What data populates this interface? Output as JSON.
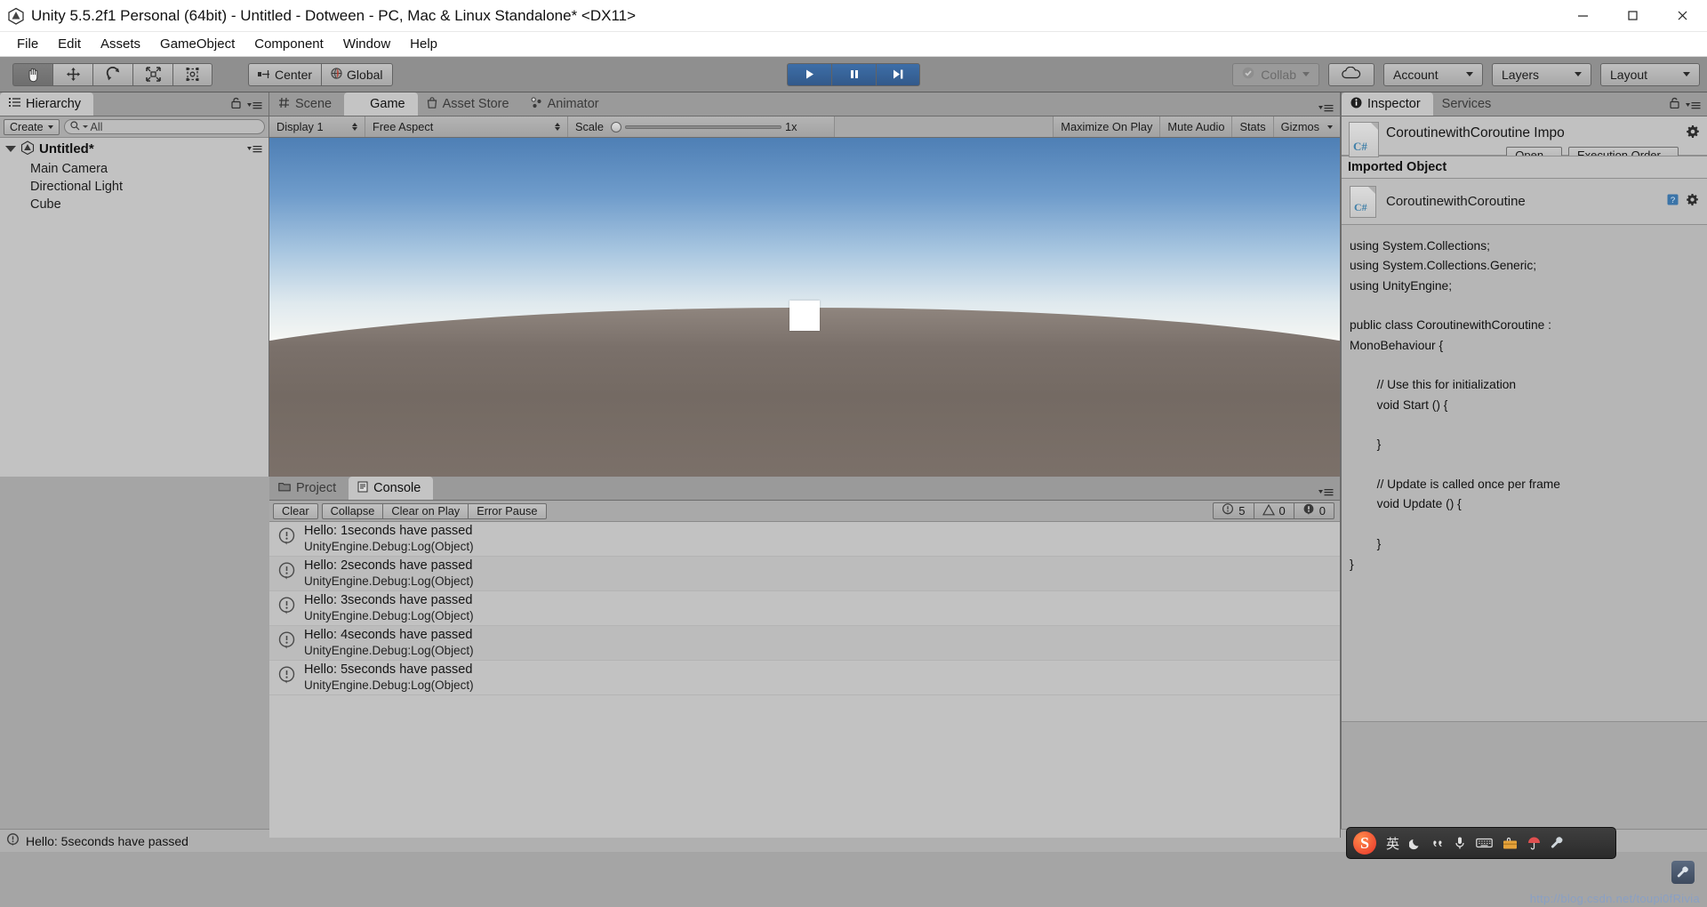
{
  "window": {
    "title": "Unity 5.5.2f1 Personal (64bit) - Untitled - Dotween - PC, Mac & Linux Standalone* <DX11>",
    "logo_icon": "unity-logo-icon",
    "minimize_icon": "minimize-icon",
    "maximize_icon": "maximize-icon",
    "close_icon": "close-icon"
  },
  "menubar": {
    "items": [
      {
        "label": "File"
      },
      {
        "label": "Edit"
      },
      {
        "label": "Assets"
      },
      {
        "label": "GameObject"
      },
      {
        "label": "Component"
      },
      {
        "label": "Window"
      },
      {
        "label": "Help"
      }
    ]
  },
  "toolbar": {
    "transform_tools": [
      {
        "name": "hand-tool",
        "icon": "hand-icon",
        "active": true
      },
      {
        "name": "move-tool",
        "icon": "move-arrows-icon",
        "active": false
      },
      {
        "name": "rotate-tool",
        "icon": "rotate-icon",
        "active": false
      },
      {
        "name": "scale-tool",
        "icon": "scale-icon",
        "active": false
      },
      {
        "name": "rect-tool",
        "icon": "rect-transform-icon",
        "active": false
      }
    ],
    "pivot_label": "Center",
    "pivot_icon": "pivot-center-icon",
    "space_label": "Global",
    "space_icon": "globe-icon",
    "play_label": "play-icon",
    "pause_label": "pause-icon",
    "step_label": "step-icon",
    "collab_label": "Collab",
    "collab_icon": "collab-check-icon",
    "cloud_icon": "cloud-icon",
    "account_label": "Account",
    "layers_label": "Layers",
    "layout_label": "Layout"
  },
  "hierarchy": {
    "tab_label": "Hierarchy",
    "tab_icon": "hierarchy-icon",
    "lock_icon": "lock-icon",
    "menu_icon": "panel-menu-icon",
    "create_label": "Create",
    "search_placeholder": "All",
    "search_icon": "search-icon",
    "scene_root": "Untitled*",
    "scene_icon": "unity-scene-icon",
    "objects": [
      {
        "label": "Main Camera"
      },
      {
        "label": "Directional Light"
      },
      {
        "label": "Cube"
      }
    ]
  },
  "center_tabs": [
    {
      "label": "Scene",
      "icon": "scene-grid-icon",
      "active": false
    },
    {
      "label": "Game",
      "icon": "game-pacman-icon",
      "active": true
    },
    {
      "label": "Asset Store",
      "icon": "asset-store-bag-icon",
      "active": false
    },
    {
      "label": "Animator",
      "icon": "animator-icon",
      "active": false
    }
  ],
  "game_toolbar": {
    "display_label": "Display 1",
    "aspect_label": "Free Aspect",
    "scale_label": "Scale",
    "scale_value": "1x",
    "maximize_label": "Maximize On Play",
    "mute_label": "Mute Audio",
    "stats_label": "Stats",
    "gizmos_label": "Gizmos"
  },
  "console": {
    "project_tab": "Project",
    "project_icon": "folder-icon",
    "console_tab": "Console",
    "console_icon": "console-icon",
    "buttons": [
      {
        "label": "Clear"
      },
      {
        "label": "Collapse"
      },
      {
        "label": "Clear on Play"
      },
      {
        "label": "Error Pause"
      }
    ],
    "counters": [
      {
        "icon": "info-icon",
        "value": "5"
      },
      {
        "icon": "warning-icon",
        "value": "0"
      },
      {
        "icon": "error-icon",
        "value": "0"
      }
    ],
    "logs": [
      {
        "icon": "info-icon",
        "message": "Hello: 1seconds have passed",
        "trace": "UnityEngine.Debug:Log(Object)"
      },
      {
        "icon": "info-icon",
        "message": "Hello: 2seconds have passed",
        "trace": "UnityEngine.Debug:Log(Object)"
      },
      {
        "icon": "info-icon",
        "message": "Hello: 3seconds have passed",
        "trace": "UnityEngine.Debug:Log(Object)"
      },
      {
        "icon": "info-icon",
        "message": "Hello: 4seconds have passed",
        "trace": "UnityEngine.Debug:Log(Object)"
      },
      {
        "icon": "info-icon",
        "message": "Hello: 5seconds have passed",
        "trace": "UnityEngine.Debug:Log(Object)"
      }
    ]
  },
  "statusbar": {
    "icon": "info-icon",
    "message": "Hello: 5seconds have passed"
  },
  "inspector": {
    "tabs": [
      {
        "label": "Inspector",
        "icon": "info-circle-icon",
        "active": true
      },
      {
        "label": "Services",
        "icon": "services-icon",
        "active": false
      }
    ],
    "lock_icon": "lock-icon",
    "menu_icon": "panel-menu-icon",
    "asset_title": "CoroutinewithCoroutine Impo",
    "asset_icon": "csharp-script-icon",
    "gear_icon": "gear-icon",
    "open_label": "Open...",
    "execution_order_label": "Execution Order...",
    "section_label": "Imported Object",
    "object_name": "CoroutinewithCoroutine",
    "help_icon": "help-book-icon",
    "code": "using System.Collections;\nusing System.Collections.Generic;\nusing UnityEngine;\n\npublic class CoroutinewithCoroutine :\nMonoBehaviour {\n\n        // Use this for initialization\n        void Start () {\n\n        }\n\n        // Update is called once per frame\n        void Update () {\n\n        }\n}"
  },
  "ime": {
    "logo": "S",
    "mode_label": "英",
    "items": [
      {
        "icon": "moon-icon"
      },
      {
        "icon": "quote-icon"
      },
      {
        "icon": "microphone-icon"
      },
      {
        "icon": "keyboard-icon"
      },
      {
        "icon": "toolbox-icon"
      },
      {
        "icon": "umbrella-icon"
      },
      {
        "icon": "wrench-icon"
      }
    ]
  },
  "watermark": {
    "text": "http://blog.csdn.net/toupi0fRivia"
  },
  "colors": {
    "toolbar_bg": "#8f8f8f",
    "panel_bg": "#c2c2c2",
    "inspector_bg": "#b6b6b6",
    "accent_blue": "#3d6ea8",
    "csharp_blue": "#3f7fa8"
  }
}
